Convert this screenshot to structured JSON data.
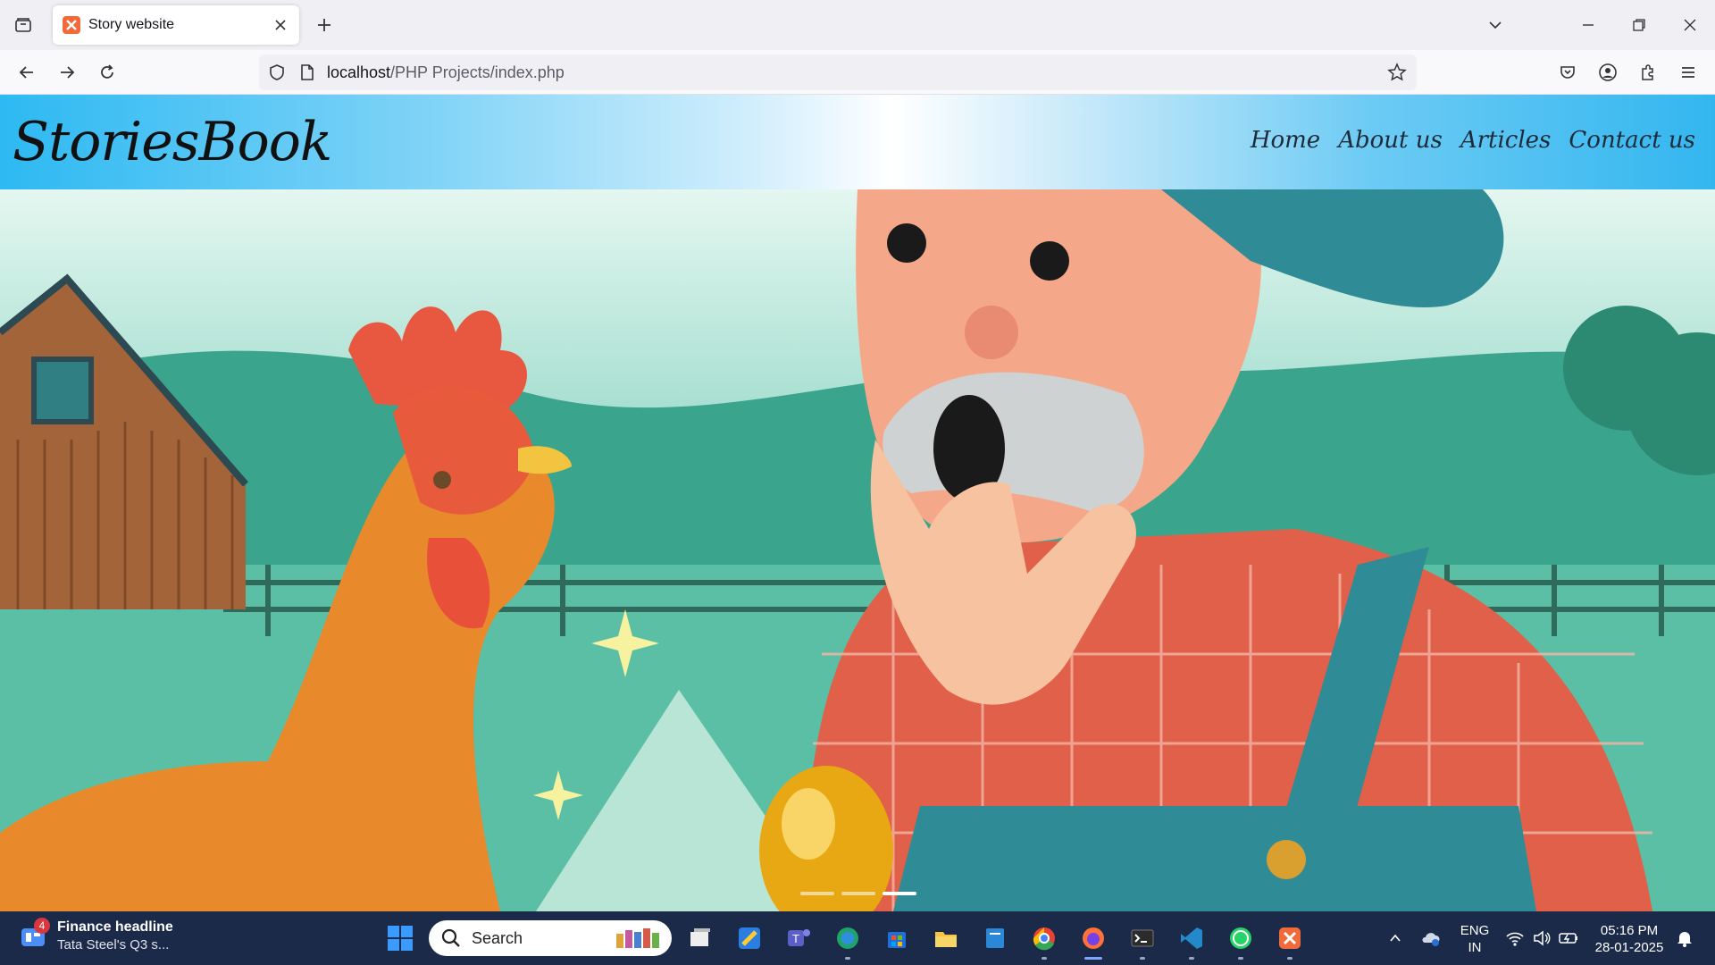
{
  "browser": {
    "tab_title": "Story website",
    "url_host": "localhost",
    "url_path": "/PHP Projects/index.php"
  },
  "site": {
    "logo": "StoriesBook",
    "menu": [
      "Home",
      "About us",
      "Articles",
      "Contact us"
    ]
  },
  "carousel": {
    "slide_count": 3,
    "active_index": 2
  },
  "taskbar": {
    "news_badge": "4",
    "news_title": "Finance headline",
    "news_sub": "Tata Steel's Q3 s...",
    "search_label": "Search",
    "lang_line1": "ENG",
    "lang_line2": "IN",
    "time": "05:16 PM",
    "date": "28-01-2025"
  }
}
